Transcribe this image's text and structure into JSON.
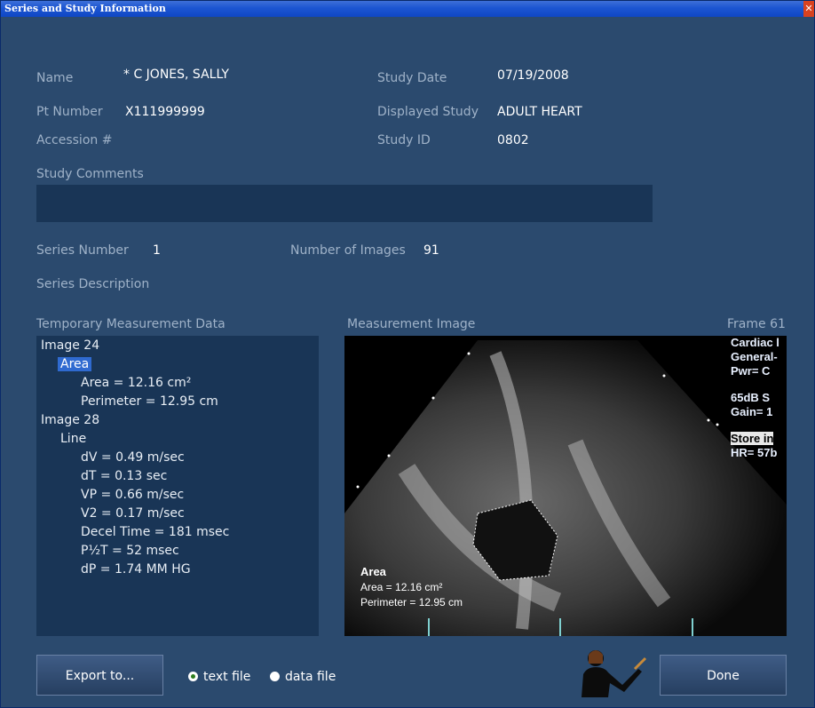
{
  "window": {
    "title": "Series and Study Information",
    "close": "✕"
  },
  "study": {
    "name_label": "Name",
    "name_value": "* C JONES, SALLY",
    "pt_label": "Pt Number",
    "pt_value": "X111999999",
    "accession_label": "Accession #",
    "accession_value": "",
    "date_label": "Study Date",
    "date_value": "07/19/2008",
    "displayed_label": "Displayed Study",
    "displayed_value": "ADULT HEART",
    "id_label": "Study ID",
    "id_value": "0802",
    "comments_label": "Study Comments",
    "comments_value": ""
  },
  "series": {
    "number_label": "Series Number",
    "number_value": "1",
    "images_label": "Number of Images",
    "images_value": "91",
    "description_label": "Series Description"
  },
  "measurements": {
    "title": "Temporary Measurement Data",
    "tree": [
      "Image 24",
      "Area",
      "Area = 12.16 cm²",
      "Perimeter = 12.95 cm",
      "Image 28",
      "Line",
      "dV = 0.49 m/sec",
      "dT = 0.13 sec",
      "VP = 0.66 m/sec",
      "V2 = 0.17 m/sec",
      "Decel Time = 181 msec",
      "P½T = 52 msec",
      "dP = 1.74 MM HG"
    ]
  },
  "image": {
    "title": "Measurement Image",
    "frame": "Frame 61",
    "overlay_right": [
      "Cardiac l",
      "General-",
      "Pwr=   C",
      "65dB   S",
      "Gain= 1",
      "Store in",
      "HR=  57b"
    ],
    "overlay_bottom": [
      "Area",
      "Area = 12.16 cm²",
      "Perimeter = 12.95 cm"
    ]
  },
  "footer": {
    "export_label": "Export to...",
    "radio_text": "text file",
    "radio_data": "data file",
    "done_label": "Done",
    "selected": "text file"
  },
  "icons": {
    "close": "close-icon",
    "assistant": "pointing-person-icon",
    "radio": "radio-icon"
  }
}
